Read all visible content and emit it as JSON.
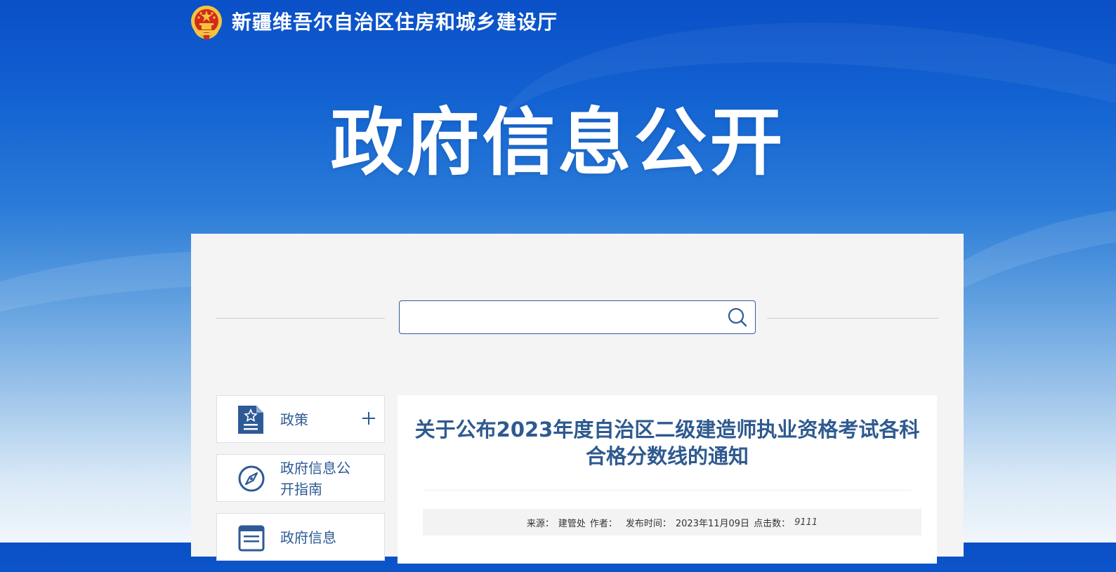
{
  "site": {
    "name": "新疆维吾尔自治区住房和城乡建设厅"
  },
  "hero": {
    "title": "政府信息公开"
  },
  "search": {
    "placeholder": "",
    "value": ""
  },
  "sidebar": {
    "items": [
      {
        "label": "政策",
        "icon": "policy-document-icon",
        "expandable": true
      },
      {
        "label": "政府信息公开指南",
        "icon": "compass-icon",
        "expandable": false
      },
      {
        "label": "政府信息",
        "icon": "list-document-icon",
        "expandable": false
      }
    ]
  },
  "article": {
    "title": "关于公布2023年度自治区二级建造师执业资格考试各科合格分数线的通知",
    "meta": {
      "source_label": "来源：",
      "source": "建管处",
      "author_label": "作者：",
      "author": "",
      "date_label": "发布时间：",
      "date": "2023年11月09日",
      "hits_label": "点击数：",
      "hits": "9111"
    }
  },
  "colors": {
    "brand_blue": "#0a4fc7",
    "link_blue": "#2e5a96",
    "title_blue": "#2e5a8f",
    "emblem_red": "#d42a1e",
    "emblem_gold": "#f2c53d"
  }
}
